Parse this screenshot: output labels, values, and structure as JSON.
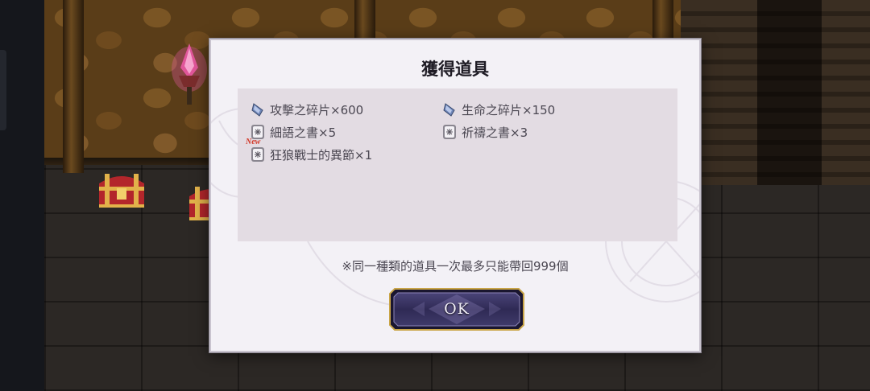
{
  "dialog": {
    "title": "獲得道具",
    "note": "※同一種類的道具一次最多只能帶回999個",
    "ok_label": "OK",
    "items": [
      {
        "icon": "attack-shard-icon",
        "text": "攻擊之碎片×600",
        "new": false
      },
      {
        "icon": "life-shard-icon",
        "text": "生命之碎片×150",
        "new": false
      },
      {
        "icon": "book-icon",
        "text": "細語之書×5",
        "new": false
      },
      {
        "icon": "book-icon",
        "text": "祈禱之書×3",
        "new": false
      },
      {
        "icon": "book-icon",
        "text": "狂狼戰士的異節×1",
        "new": true,
        "badge": "New"
      }
    ]
  },
  "colors": {
    "dialog_bg": "#f3f1f6",
    "panel_bg": "#e3dce3",
    "text": "#4b4752",
    "new_badge": "#d23a2a",
    "button_fill": "#3c3564",
    "button_border": "#c9a548"
  }
}
